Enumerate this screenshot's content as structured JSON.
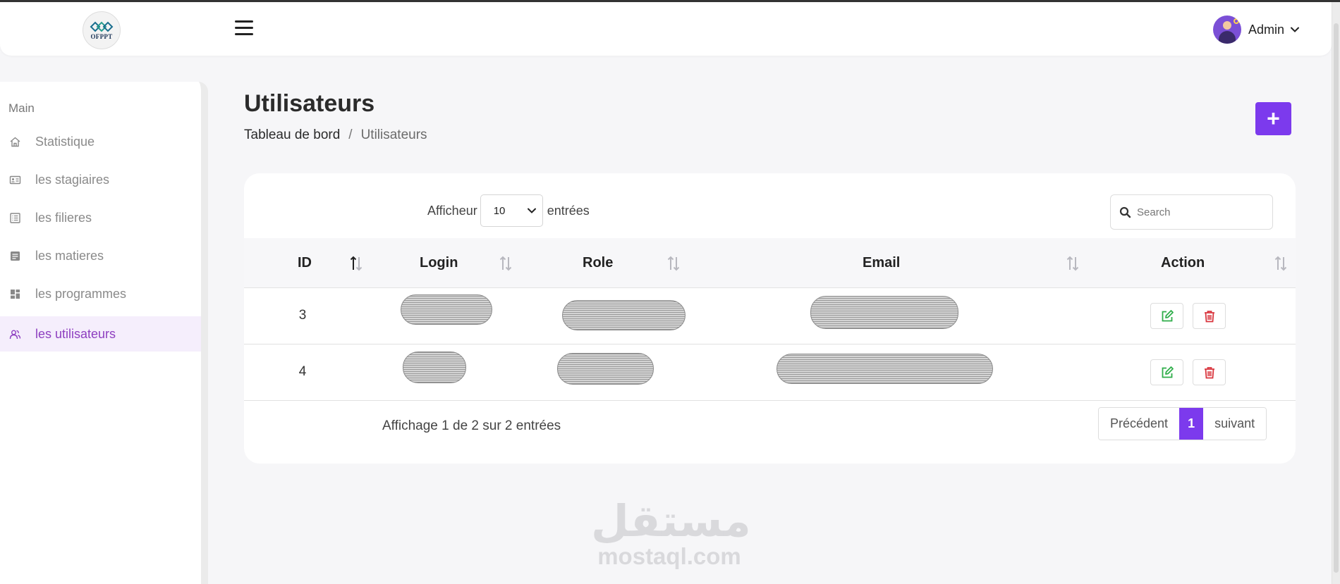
{
  "header": {
    "logo_text": "OFPPT",
    "user_name": "Admin"
  },
  "sidebar": {
    "section": "Main",
    "items": [
      {
        "label": "Statistique",
        "icon": "home-icon"
      },
      {
        "label": "les stagiaires",
        "icon": "id-card-icon"
      },
      {
        "label": "les filieres",
        "icon": "list-icon"
      },
      {
        "label": "les matieres",
        "icon": "document-icon"
      },
      {
        "label": "les programmes",
        "icon": "dashboard-icon"
      },
      {
        "label": "les utilisateurs",
        "icon": "users-icon",
        "active": true
      }
    ]
  },
  "page": {
    "title": "Utilisateurs",
    "breadcrumb": [
      "Tableau de bord",
      "/",
      "Utilisateurs"
    ],
    "add_label": "+"
  },
  "table": {
    "length_prefix": "Afficheur",
    "length_value": "10",
    "length_suffix": "entrées",
    "search_placeholder": "Search",
    "columns": [
      "ID",
      "Login",
      "Role",
      "Email",
      "Action"
    ],
    "rows": [
      {
        "id": "3"
      },
      {
        "id": "4"
      }
    ],
    "info": "Affichage 1 de 2 sur 2 entrées",
    "pagination": {
      "prev": "Précédent",
      "current": "1",
      "next": "suivant"
    }
  },
  "watermark": {
    "arabic": "مستقل",
    "latin": "mostaql.com"
  },
  "colors": {
    "accent": "#7c3aed",
    "active_text": "#8e3fc0",
    "edit": "#2fae4a",
    "delete": "#d9363e"
  }
}
